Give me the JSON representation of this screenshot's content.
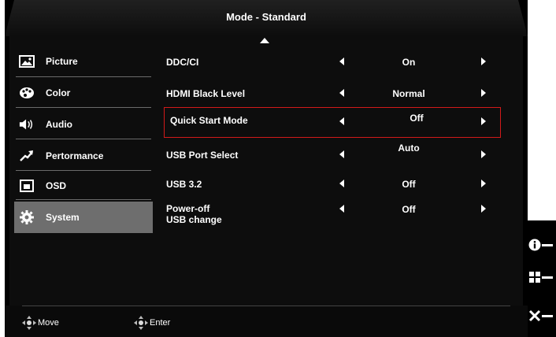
{
  "title": "Mode - Standard",
  "sidebar": {
    "items": [
      {
        "label": "Picture",
        "icon": "picture-icon",
        "active": false
      },
      {
        "label": "Color",
        "icon": "palette-icon",
        "active": false
      },
      {
        "label": "Audio",
        "icon": "speaker-icon",
        "active": false
      },
      {
        "label": "Pertormance",
        "icon": "performance-arrow-icon",
        "active": false
      },
      {
        "label": "OSD",
        "icon": "osd-window-icon",
        "active": false
      },
      {
        "label": "System",
        "icon": "gear-icon",
        "active": true
      }
    ]
  },
  "settings": [
    {
      "label": "DDC/CI",
      "value": "On",
      "selected": false
    },
    {
      "label": "HDMI Black Level",
      "value": "Normal",
      "selected": false
    },
    {
      "label": "Quick Start Mode",
      "value": "Off",
      "selected": true
    },
    {
      "label": "USB Port Select",
      "value": "Auto",
      "selected": false
    },
    {
      "label": "USB 3.2",
      "value": "Off",
      "selected": false
    },
    {
      "label": "Power-off USB change",
      "label_line1": "Power-off",
      "label_line2": "USB change",
      "value": "Off",
      "selected": false
    }
  ],
  "footer": {
    "move_label": "Move",
    "enter_label": "Enter"
  },
  "side_keys": [
    "info-icon",
    "menu-grid-icon",
    "close-icon"
  ],
  "colors": {
    "selection_border": "#d21a1a",
    "active_item": "#6e6e6e"
  }
}
